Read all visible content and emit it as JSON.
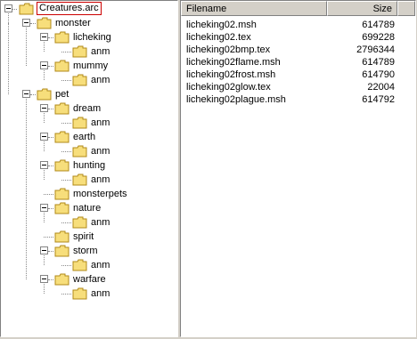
{
  "tree": {
    "root": "Creatures.arc",
    "nodes": [
      {
        "label": "monster",
        "expanded": true
      },
      {
        "label": "licheking",
        "expanded": true
      },
      {
        "label": "anm",
        "expanded": false
      },
      {
        "label": "mummy",
        "expanded": true
      },
      {
        "label": "anm",
        "expanded": false
      },
      {
        "label": "pet",
        "expanded": true
      },
      {
        "label": "dream",
        "expanded": true
      },
      {
        "label": "anm",
        "expanded": false
      },
      {
        "label": "earth",
        "expanded": true
      },
      {
        "label": "anm",
        "expanded": false
      },
      {
        "label": "hunting",
        "expanded": true
      },
      {
        "label": "anm",
        "expanded": false
      },
      {
        "label": "monsterpets",
        "expanded": false
      },
      {
        "label": "nature",
        "expanded": true
      },
      {
        "label": "anm",
        "expanded": false
      },
      {
        "label": "spirit",
        "expanded": false
      },
      {
        "label": "storm",
        "expanded": true
      },
      {
        "label": "anm",
        "expanded": false
      },
      {
        "label": "warfare",
        "expanded": true
      },
      {
        "label": "anm",
        "expanded": false
      }
    ]
  },
  "list": {
    "columns": {
      "filename": "Filename",
      "size": "Size"
    },
    "files": [
      {
        "name": "licheking02.msh",
        "size": "614789"
      },
      {
        "name": "licheking02.tex",
        "size": "699228"
      },
      {
        "name": "licheking02bmp.tex",
        "size": "2796344"
      },
      {
        "name": "licheking02flame.msh",
        "size": "614789"
      },
      {
        "name": "licheking02frost.msh",
        "size": "614790"
      },
      {
        "name": "licheking02glow.tex",
        "size": "22004"
      },
      {
        "name": "licheking02plague.msh",
        "size": "614792"
      }
    ]
  },
  "colors": {
    "folder": "#f7de7b",
    "folder_outline": "#b08a18"
  },
  "icons": {
    "folder": "folder-icon",
    "expander": "collapse-box-icon"
  }
}
